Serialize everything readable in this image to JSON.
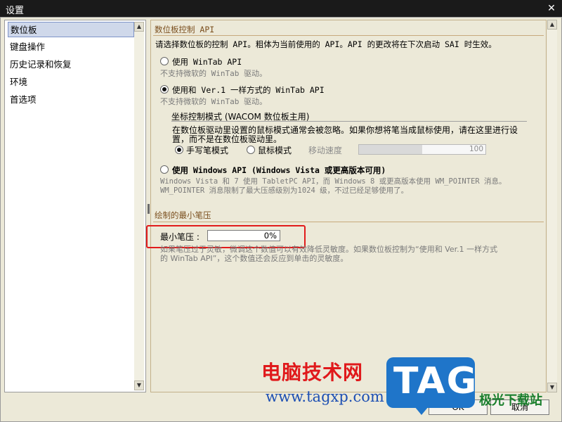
{
  "window": {
    "title": "设置",
    "close_glyph": "✕"
  },
  "sidebar": {
    "items": [
      {
        "label": "数位板",
        "selected": true
      },
      {
        "label": "键盘操作",
        "selected": false
      },
      {
        "label": "历史记录和恢复",
        "selected": false
      },
      {
        "label": "环境",
        "selected": false
      },
      {
        "label": "首选项",
        "selected": false
      }
    ]
  },
  "tablet_api": {
    "section_title": "数位板控制 API",
    "description": "请选择数位板的控制 API。粗体为当前使用的 API。API 的更改将在下次启动 SAI 时生效。",
    "options": [
      {
        "label": "使用 WinTab API",
        "hint": "不支持微软的 WinTab 驱动。",
        "checked": false
      },
      {
        "label": "使用和 Ver.1 一样方式的 WinTab API",
        "hint": "不支持微软的 WinTab 驱动。",
        "checked": true
      }
    ],
    "coord_mode": {
      "title": "坐标控制模式 (WACOM 数位板主用)",
      "description_line1": "在数位板驱动里设置的鼠标模式通常会被忽略。如果你想将笔当成鼠标使用，请在这里进行设",
      "description_line2": "置，而不是在数位板驱动里。",
      "pen_mode": "手写笔模式",
      "mouse_mode": "鼠标模式",
      "pen_mode_checked": true,
      "speed_label": "移动速度",
      "speed_value": "100",
      "speed_fill": 0.5
    },
    "windows_api": {
      "label": "使用 Windows API (Windows Vista 或更高版本可用)",
      "checked": false,
      "hint_line1": "Windows Vista 和 7 使用 TabletPC API，而 Windows 8 或更高版本使用 WM_POINTER 消息。",
      "hint_line2": "WM_POINTER 消息限制了最大压感级别为1024 级，不过已经足够使用了。"
    }
  },
  "min_pressure": {
    "section_title": "绘制的最小笔压",
    "label": "最小笔压 :",
    "value": "0%",
    "hint_line1": "如果笔压过于灵敏，微调这个数值可以有效降低灵敏度。如果数位板控制为“使用和 Ver.1 一样方式",
    "hint_line2": "的 WinTab API”，这个数值还会反应到单击的灵敏度。"
  },
  "buttons": {
    "ok": "OK",
    "cancel": "取消"
  },
  "watermark": {
    "cn_text": "电脑技术网",
    "url": "www.tagxp.com",
    "logo": "TAG",
    "site": "极光下载站"
  },
  "colors": {
    "highlight": "#e21b1b",
    "section_title": "#7a4e1d"
  }
}
